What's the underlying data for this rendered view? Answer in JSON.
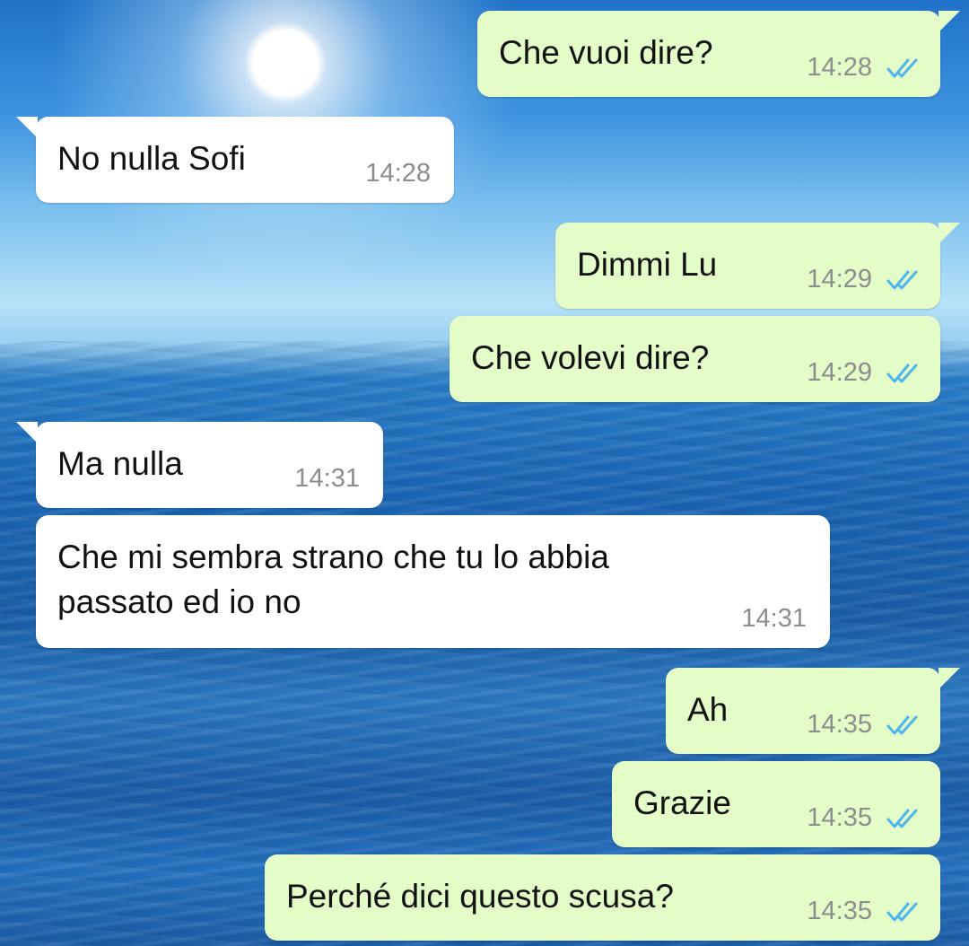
{
  "chat": {
    "messages": [
      {
        "direction": "out",
        "text": "Che vuoi dire?",
        "time": "14:28",
        "status": "read-double-check-icon"
      },
      {
        "direction": "in",
        "text": "No nulla Sofi",
        "time": "14:28"
      },
      {
        "direction": "out",
        "text": "Dimmi Lu",
        "time": "14:29",
        "status": "read-double-check-icon"
      },
      {
        "direction": "out",
        "text": "Che volevi dire?",
        "time": "14:29",
        "status": "read-double-check-icon"
      },
      {
        "direction": "in",
        "text": "Ma nulla",
        "time": "14:31"
      },
      {
        "direction": "in",
        "text": "Che mi sembra strano che tu lo abbia\npassato ed io no",
        "time": "14:31"
      },
      {
        "direction": "out",
        "text": "Ah",
        "time": "14:35",
        "status": "read-double-check-icon"
      },
      {
        "direction": "out",
        "text": "Grazie",
        "time": "14:35",
        "status": "read-double-check-icon"
      },
      {
        "direction": "out",
        "text": "Perché dici questo scusa?",
        "time": "14:35",
        "status": "read-double-check-icon"
      }
    ]
  },
  "colors": {
    "outgoing_bubble": "#e3fcc8",
    "incoming_bubble": "#ffffff",
    "read_ticks": "#4fb6ec",
    "timestamp": "#8d8d8d"
  }
}
